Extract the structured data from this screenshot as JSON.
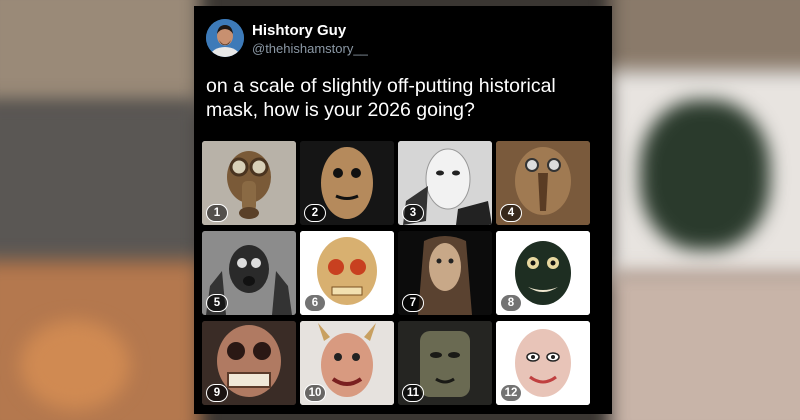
{
  "tweet": {
    "author_name": "Hishtory Guy",
    "author_handle": "@thehishamstory__",
    "text": "on a scale of slightly off-putting historical mask, how is your 2026 going?"
  },
  "masks": [
    {
      "number": "1"
    },
    {
      "number": "2"
    },
    {
      "number": "3"
    },
    {
      "number": "4"
    },
    {
      "number": "5"
    },
    {
      "number": "6"
    },
    {
      "number": "7"
    },
    {
      "number": "8"
    },
    {
      "number": "9"
    },
    {
      "number": "10"
    },
    {
      "number": "11"
    },
    {
      "number": "12"
    }
  ],
  "colors": {
    "card_background": "#000000",
    "name_text": "#ffffff",
    "handle_text": "#8b98a5"
  }
}
